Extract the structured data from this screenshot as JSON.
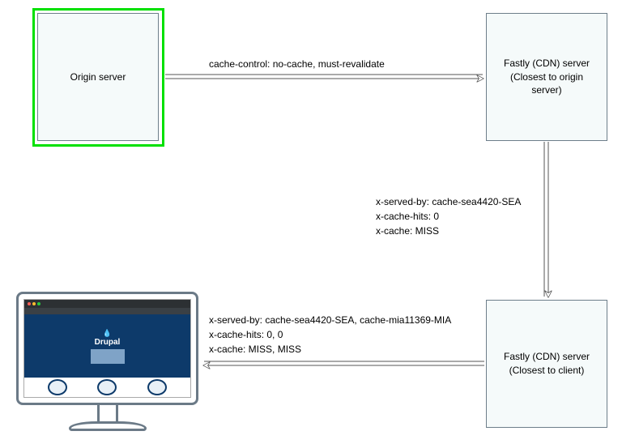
{
  "nodes": {
    "origin": {
      "label": "Origin server"
    },
    "cdn_origin": {
      "label": "Fastly (CDN) server\n(Closest to origin\nserver)"
    },
    "cdn_client": {
      "label": "Fastly (CDN) server\n(Closest to client)"
    }
  },
  "edges": {
    "origin_to_cdn": {
      "label": "cache-control: no-cache, must-revalidate"
    },
    "cdn_to_cdn": {
      "label": "x-served-by: cache-sea4420-SEA\nx-cache-hits: 0\nx-cache: MISS"
    },
    "cdn_to_client": {
      "label": "x-served-by: cache-sea4420-SEA, cache-mia11369-MIA\nx-cache-hits: 0, 0\nx-cache: MISS, MISS"
    }
  },
  "client": {
    "site_name": "Drupal"
  },
  "colors": {
    "highlight": "#00e000",
    "box_fill": "#f5fafa",
    "box_stroke": "#6d7e8a"
  }
}
